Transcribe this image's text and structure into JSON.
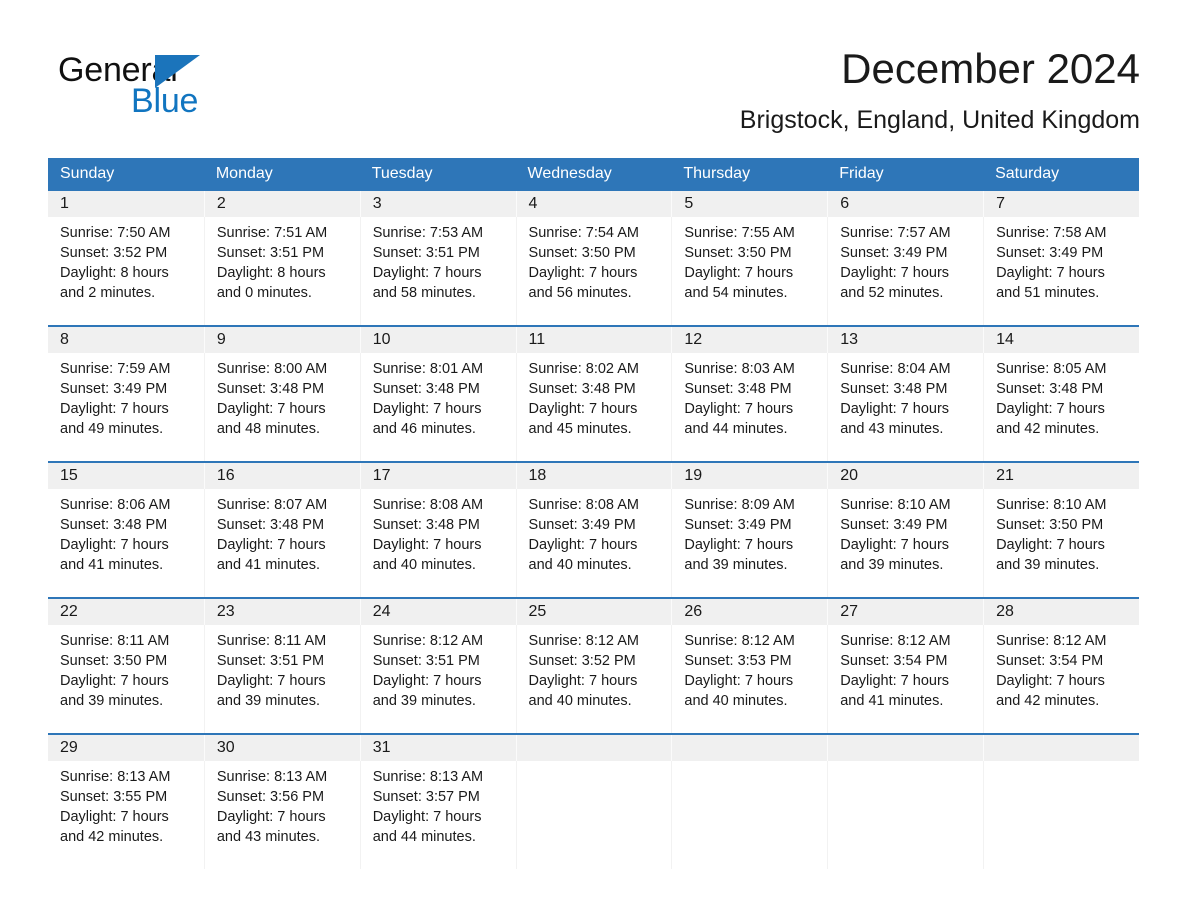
{
  "brand": {
    "name_part1": "General",
    "name_part2": "Blue",
    "triangle_color": "#1b74bb",
    "blue_text_color": "#1175c0"
  },
  "header": {
    "month_title": "December 2024",
    "location": "Brigstock, England, United Kingdom"
  },
  "theme": {
    "header_blue": "#2e76b8",
    "daynum_band": "#f0f0f0",
    "text": "#1a1a1a"
  },
  "calendar": {
    "weekday_headers": [
      "Sunday",
      "Monday",
      "Tuesday",
      "Wednesday",
      "Thursday",
      "Friday",
      "Saturday"
    ],
    "weeks": [
      {
        "days": [
          {
            "num": "1",
            "text": "Sunrise: 7:50 AM\nSunset: 3:52 PM\nDaylight: 8 hours\nand 2 minutes."
          },
          {
            "num": "2",
            "text": "Sunrise: 7:51 AM\nSunset: 3:51 PM\nDaylight: 8 hours\nand 0 minutes."
          },
          {
            "num": "3",
            "text": "Sunrise: 7:53 AM\nSunset: 3:51 PM\nDaylight: 7 hours\nand 58 minutes."
          },
          {
            "num": "4",
            "text": "Sunrise: 7:54 AM\nSunset: 3:50 PM\nDaylight: 7 hours\nand 56 minutes."
          },
          {
            "num": "5",
            "text": "Sunrise: 7:55 AM\nSunset: 3:50 PM\nDaylight: 7 hours\nand 54 minutes."
          },
          {
            "num": "6",
            "text": "Sunrise: 7:57 AM\nSunset: 3:49 PM\nDaylight: 7 hours\nand 52 minutes."
          },
          {
            "num": "7",
            "text": "Sunrise: 7:58 AM\nSunset: 3:49 PM\nDaylight: 7 hours\nand 51 minutes."
          }
        ]
      },
      {
        "days": [
          {
            "num": "8",
            "text": "Sunrise: 7:59 AM\nSunset: 3:49 PM\nDaylight: 7 hours\nand 49 minutes."
          },
          {
            "num": "9",
            "text": "Sunrise: 8:00 AM\nSunset: 3:48 PM\nDaylight: 7 hours\nand 48 minutes."
          },
          {
            "num": "10",
            "text": "Sunrise: 8:01 AM\nSunset: 3:48 PM\nDaylight: 7 hours\nand 46 minutes."
          },
          {
            "num": "11",
            "text": "Sunrise: 8:02 AM\nSunset: 3:48 PM\nDaylight: 7 hours\nand 45 minutes."
          },
          {
            "num": "12",
            "text": "Sunrise: 8:03 AM\nSunset: 3:48 PM\nDaylight: 7 hours\nand 44 minutes."
          },
          {
            "num": "13",
            "text": "Sunrise: 8:04 AM\nSunset: 3:48 PM\nDaylight: 7 hours\nand 43 minutes."
          },
          {
            "num": "14",
            "text": "Sunrise: 8:05 AM\nSunset: 3:48 PM\nDaylight: 7 hours\nand 42 minutes."
          }
        ]
      },
      {
        "days": [
          {
            "num": "15",
            "text": "Sunrise: 8:06 AM\nSunset: 3:48 PM\nDaylight: 7 hours\nand 41 minutes."
          },
          {
            "num": "16",
            "text": "Sunrise: 8:07 AM\nSunset: 3:48 PM\nDaylight: 7 hours\nand 41 minutes."
          },
          {
            "num": "17",
            "text": "Sunrise: 8:08 AM\nSunset: 3:48 PM\nDaylight: 7 hours\nand 40 minutes."
          },
          {
            "num": "18",
            "text": "Sunrise: 8:08 AM\nSunset: 3:49 PM\nDaylight: 7 hours\nand 40 minutes."
          },
          {
            "num": "19",
            "text": "Sunrise: 8:09 AM\nSunset: 3:49 PM\nDaylight: 7 hours\nand 39 minutes."
          },
          {
            "num": "20",
            "text": "Sunrise: 8:10 AM\nSunset: 3:49 PM\nDaylight: 7 hours\nand 39 minutes."
          },
          {
            "num": "21",
            "text": "Sunrise: 8:10 AM\nSunset: 3:50 PM\nDaylight: 7 hours\nand 39 minutes."
          }
        ]
      },
      {
        "days": [
          {
            "num": "22",
            "text": "Sunrise: 8:11 AM\nSunset: 3:50 PM\nDaylight: 7 hours\nand 39 minutes."
          },
          {
            "num": "23",
            "text": "Sunrise: 8:11 AM\nSunset: 3:51 PM\nDaylight: 7 hours\nand 39 minutes."
          },
          {
            "num": "24",
            "text": "Sunrise: 8:12 AM\nSunset: 3:51 PM\nDaylight: 7 hours\nand 39 minutes."
          },
          {
            "num": "25",
            "text": "Sunrise: 8:12 AM\nSunset: 3:52 PM\nDaylight: 7 hours\nand 40 minutes."
          },
          {
            "num": "26",
            "text": "Sunrise: 8:12 AM\nSunset: 3:53 PM\nDaylight: 7 hours\nand 40 minutes."
          },
          {
            "num": "27",
            "text": "Sunrise: 8:12 AM\nSunset: 3:54 PM\nDaylight: 7 hours\nand 41 minutes."
          },
          {
            "num": "28",
            "text": "Sunrise: 8:12 AM\nSunset: 3:54 PM\nDaylight: 7 hours\nand 42 minutes."
          }
        ]
      },
      {
        "days": [
          {
            "num": "29",
            "text": "Sunrise: 8:13 AM\nSunset: 3:55 PM\nDaylight: 7 hours\nand 42 minutes."
          },
          {
            "num": "30",
            "text": "Sunrise: 8:13 AM\nSunset: 3:56 PM\nDaylight: 7 hours\nand 43 minutes."
          },
          {
            "num": "31",
            "text": "Sunrise: 8:13 AM\nSunset: 3:57 PM\nDaylight: 7 hours\nand 44 minutes."
          },
          {
            "num": "",
            "text": ""
          },
          {
            "num": "",
            "text": ""
          },
          {
            "num": "",
            "text": ""
          },
          {
            "num": "",
            "text": ""
          }
        ]
      }
    ]
  }
}
